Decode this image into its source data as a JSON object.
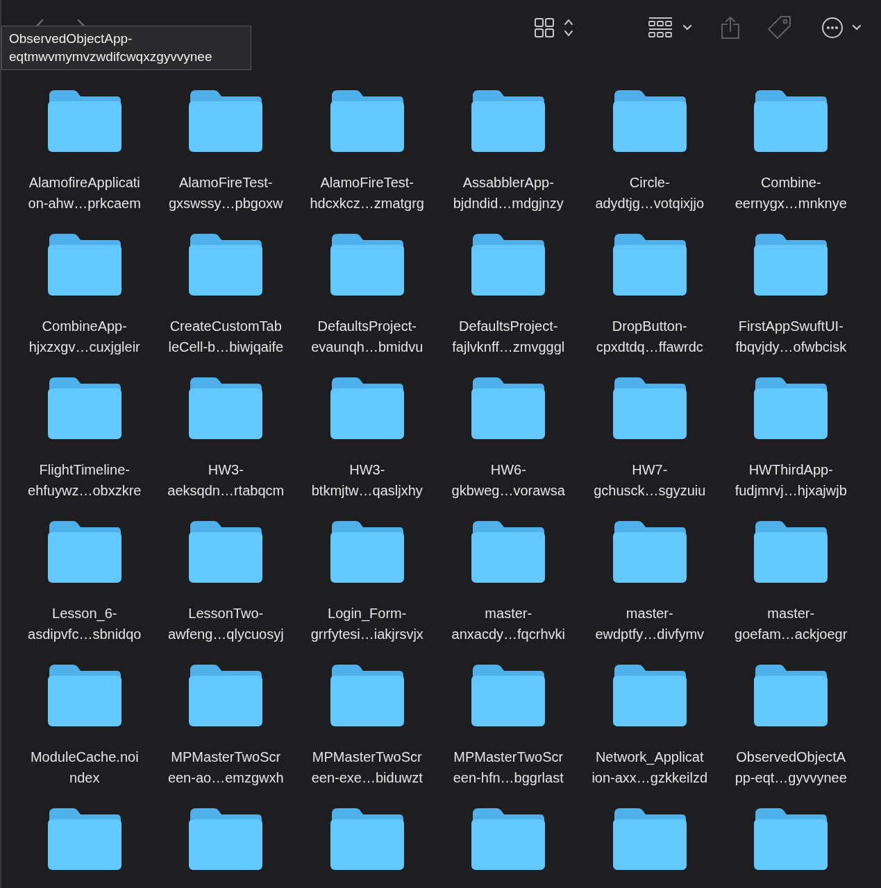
{
  "tooltip": {
    "text": "ObservedObjectApp-\neqtmwvmymvzwdifcwqxzgyvvynee"
  },
  "items": [
    {
      "name": "AlamofireApplicati\non-ahw…prkcaem"
    },
    {
      "name": "AlamoFireTest-\ngxswssy…pbgoxw"
    },
    {
      "name": "AlamoFireTest-\nhdcxkcz…zmatgrg"
    },
    {
      "name": "AssabblerApp-\nbjdndid…mdgjnzy"
    },
    {
      "name": "Circle-\nadydtjg…votqixjjo"
    },
    {
      "name": "Combine-\neernygx…mnknye"
    },
    {
      "name": "CombineApp-\nhjxzxgv…cuxjgleir"
    },
    {
      "name": "CreateCustomTab\nleCell-b…biwjqaife"
    },
    {
      "name": "DefaultsProject-\nevaunqh…bmidvu"
    },
    {
      "name": "DefaultsProject-\nfajlvknff…zmvgggl"
    },
    {
      "name": "DropButton-\ncpxdtdq…ffawrdc"
    },
    {
      "name": "FirstAppSwuftUI-\nfbqvjdy…ofwbcisk"
    },
    {
      "name": "FlightTimeline-\nehfuywz…obxzkre"
    },
    {
      "name": "HW3-\naeksqdn…rtabqcm"
    },
    {
      "name": "HW3-\nbtkmjtw…qasljxhy"
    },
    {
      "name": "HW6-\ngkbweg…vorawsa"
    },
    {
      "name": "HW7-\ngchusck…sgyzuiu"
    },
    {
      "name": "HWThirdApp-\nfudjmrvj…hjxajwjb"
    },
    {
      "name": "Lesson_6-\nasdipvfc…sbnidqo"
    },
    {
      "name": "LessonTwo-\nawfeng…qlycuosyj"
    },
    {
      "name": "Login_Form-\ngrrfytesi…iakjrsvjx"
    },
    {
      "name": "master-\nanxacdy…fqcrhvki"
    },
    {
      "name": "master-\newdptfy…divfymv"
    },
    {
      "name": "master-\ngoefam…ackjoegr"
    },
    {
      "name": "ModuleCache.noi\nndex"
    },
    {
      "name": "MPMasterTwoScr\neen-ao…emzgwxh"
    },
    {
      "name": "MPMasterTwoScr\neen-exe…biduwzt"
    },
    {
      "name": "MPMasterTwoScr\neen-hfn…bggrlast"
    },
    {
      "name": "Network_Applicat\nion-axx…gzkkeilzd"
    },
    {
      "name": "ObservedObjectA\npp-eqt…gyvvynee"
    },
    {
      "kind": "folder"
    },
    {
      "kind": "folder"
    },
    {
      "kind": "folder"
    },
    {
      "kind": "folder"
    },
    {
      "kind": "folder"
    },
    {
      "kind": "folder"
    }
  ]
}
